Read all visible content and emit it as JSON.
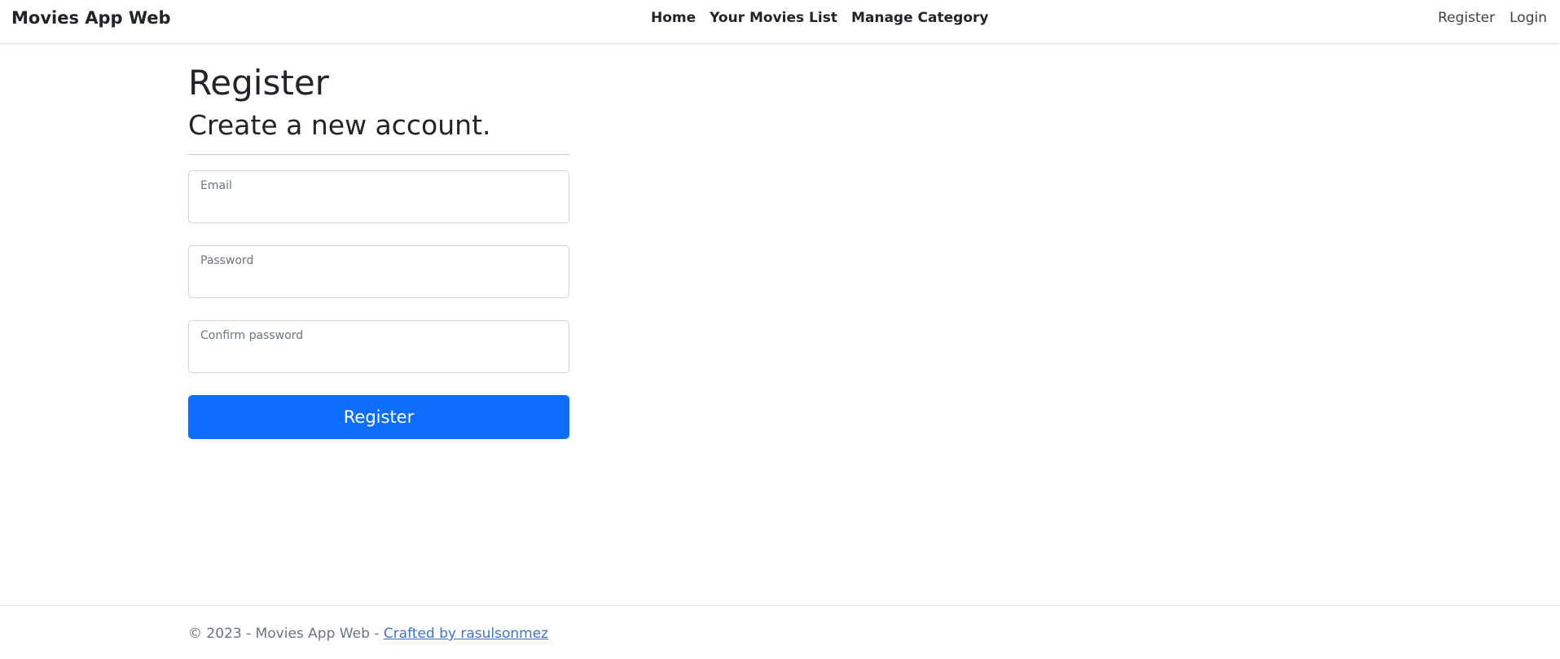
{
  "navbar": {
    "brand": "Movies App Web",
    "links": [
      "Home",
      "Your Movies List",
      "Manage Category"
    ],
    "auth_links": [
      "Register",
      "Login"
    ]
  },
  "main": {
    "title": "Register",
    "subtitle": "Create a new account.",
    "fields": [
      {
        "label": "Email",
        "value": ""
      },
      {
        "label": "Password",
        "value": ""
      },
      {
        "label": "Confirm password",
        "value": ""
      }
    ],
    "submit_label": "Register"
  },
  "footer": {
    "copyright": "© 2023 - Movies App Web - ",
    "credit_link": "Crafted by rasulsonmez"
  },
  "colors": {
    "primary": "#0d6efd",
    "link": "#3b73d6",
    "text": "#212529",
    "muted": "#6c757d"
  }
}
